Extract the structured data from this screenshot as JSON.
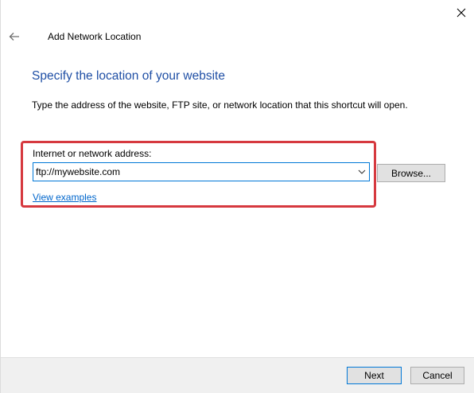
{
  "window": {
    "title": "Add Network Location"
  },
  "content": {
    "heading": "Specify the location of your website",
    "instruction": "Type the address of the website, FTP site, or network location that this shortcut will open."
  },
  "address": {
    "label": "Internet or network address:",
    "value": "ftp://mywebsite.com",
    "examples_link": "View examples",
    "browse_label": "Browse..."
  },
  "footer": {
    "next_label": "Next",
    "cancel_label": "Cancel"
  },
  "icons": {
    "close": "close-icon",
    "back": "back-arrow-icon",
    "dropdown": "chevron-down-icon"
  },
  "colors": {
    "heading": "#1f4fa5",
    "link": "#0066cc",
    "highlight": "#d6393f",
    "focus_border": "#0078d7"
  }
}
